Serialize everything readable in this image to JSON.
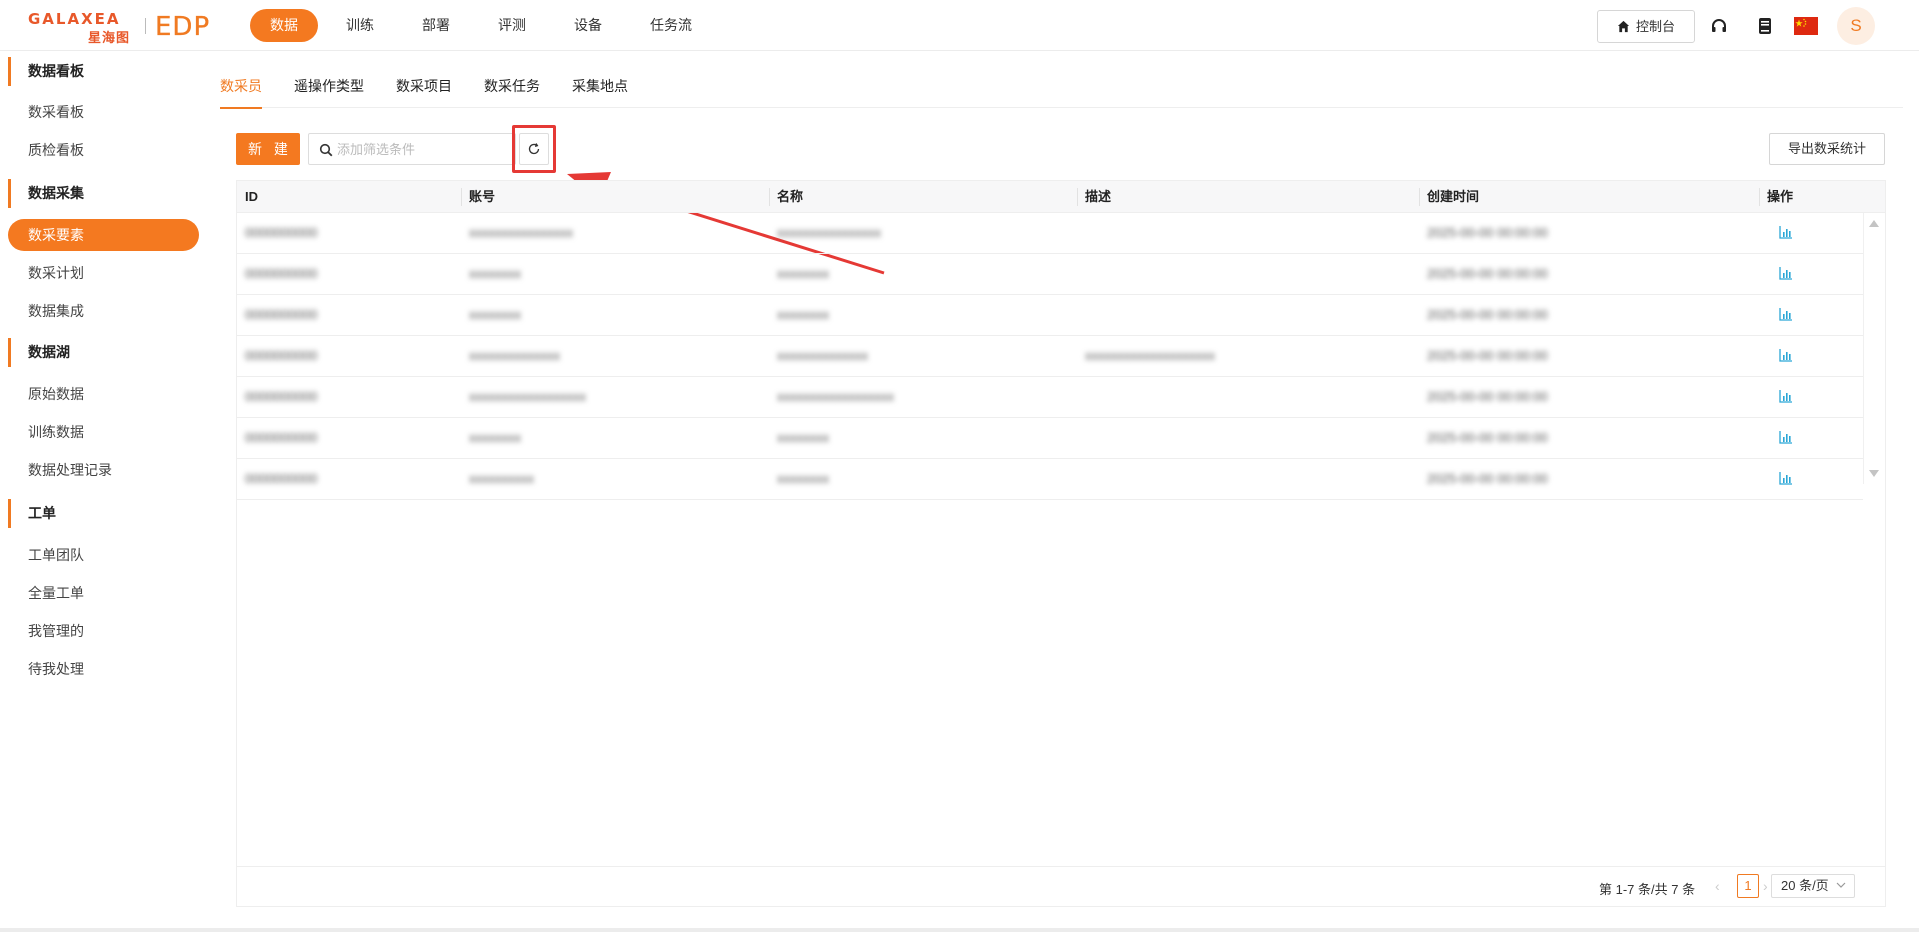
{
  "logo": {
    "brand": "GALAXEA",
    "brand_cn": "星海图",
    "product": "EDP"
  },
  "nav": [
    {
      "label": "数据",
      "active": true
    },
    {
      "label": "训练"
    },
    {
      "label": "部署"
    },
    {
      "label": "评测"
    },
    {
      "label": "设备"
    },
    {
      "label": "任务流"
    }
  ],
  "topright": {
    "console_label": "控制台",
    "avatar_initial": "S",
    "icons": [
      "home-icon",
      "headset-icon",
      "book-icon",
      "china-flag-icon"
    ]
  },
  "sidebar": {
    "groups": [
      {
        "title": "数据看板",
        "items": [
          {
            "label": "数采看板"
          },
          {
            "label": "质检看板"
          }
        ]
      },
      {
        "title": "数据采集",
        "items": [
          {
            "label": "数采要素",
            "active": true
          },
          {
            "label": "数采计划"
          },
          {
            "label": "数据集成"
          }
        ]
      },
      {
        "title": "数据湖",
        "items": [
          {
            "label": "原始数据"
          },
          {
            "label": "训练数据"
          },
          {
            "label": "数据处理记录"
          }
        ]
      },
      {
        "title": "工单",
        "items": [
          {
            "label": "工单团队"
          },
          {
            "label": "全量工单"
          },
          {
            "label": "我管理的"
          },
          {
            "label": "待我处理"
          }
        ]
      }
    ]
  },
  "tabs": [
    {
      "label": "数采员",
      "active": true
    },
    {
      "label": "遥操作类型"
    },
    {
      "label": "数采项目"
    },
    {
      "label": "数采任务"
    },
    {
      "label": "采集地点"
    }
  ],
  "toolbar": {
    "new_label": "新 建",
    "filter_placeholder": "添加筛选条件",
    "export_label": "导出数采统计"
  },
  "table": {
    "columns": [
      "ID",
      "账号",
      "名称",
      "描述",
      "创建时间",
      "操作"
    ],
    "rows": [
      {
        "id": "0000000000",
        "account": "xxxxxxxxxxxxxxxx",
        "name": "xxxxxxxxxxxxxxxx",
        "desc": "",
        "created": "2025-00-00 00:00:00"
      },
      {
        "id": "0000000000",
        "account": "xxxxxxxx",
        "name": "xxxxxxxx",
        "desc": "",
        "created": "2025-00-00 00:00:00"
      },
      {
        "id": "0000000000",
        "account": "xxxxxxxx",
        "name": "xxxxxxxx",
        "desc": "",
        "created": "2025-00-00 00:00:00"
      },
      {
        "id": "0000000000",
        "account": "xxxxxxxxxxxxxx",
        "name": "xxxxxxxxxxxxxx",
        "desc": "xxxxxxxxxxxxxxxxxxxx",
        "created": "2025-00-00 00:00:00"
      },
      {
        "id": "0000000000",
        "account": "xxxxxxxxxxxxxxxxxx",
        "name": "xxxxxxxxxxxxxxxxxx",
        "desc": "",
        "created": "2025-00-00 00:00:00"
      },
      {
        "id": "0000000000",
        "account": "xxxxxxxx",
        "name": "xxxxxxxx",
        "desc": "",
        "created": "2025-00-00 00:00:00"
      },
      {
        "id": "0000000000",
        "account": "xxxxxxxxxx",
        "name": "xxxxxxxx",
        "desc": "",
        "created": "2025-00-00 00:00:00"
      }
    ],
    "row_action_icon": "bar-chart-icon"
  },
  "pagination": {
    "summary": "第 1-7 条/共 7 条",
    "current_page": "1",
    "page_size": "20 条/页"
  },
  "colors": {
    "accent": "#f47920",
    "annotation": "#e53935"
  }
}
